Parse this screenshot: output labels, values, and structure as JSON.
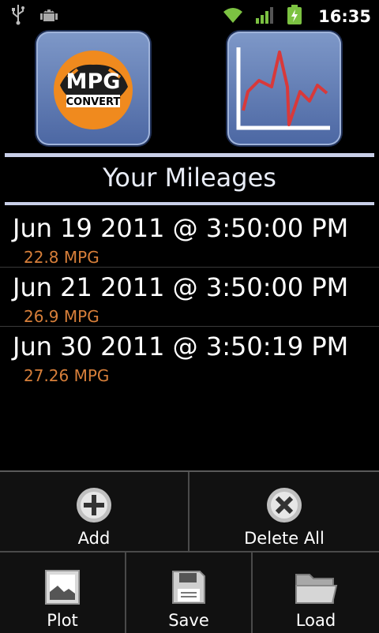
{
  "status_bar": {
    "time": "16:35",
    "icons": [
      "usb-icon",
      "android-debug-icon",
      "wifi-icon",
      "signal-icon",
      "battery-charging-icon"
    ]
  },
  "apps": {
    "mpg_logo_text": "MPG",
    "mpg_logo_subtext": "CONVERT",
    "plot_icon": "chart-icon"
  },
  "title": "Your Mileages",
  "mileages": [
    {
      "date": "Jun 19 2011 @ 3:50:00 PM",
      "mpg": "22.8 MPG"
    },
    {
      "date": "Jun 21 2011 @ 3:50:00 PM",
      "mpg": "26.9 MPG"
    },
    {
      "date": "Jun 30 2011 @ 3:50:19 PM",
      "mpg": "27.26 MPG"
    }
  ],
  "menu": {
    "add": "Add",
    "delete_all": "Delete All",
    "plot": "Plot",
    "save": "Save",
    "load": "Load"
  },
  "colors": {
    "accent_orange": "#d77f3a",
    "icon_blue": "#5a75b0",
    "divider": "#c9cfe8"
  }
}
